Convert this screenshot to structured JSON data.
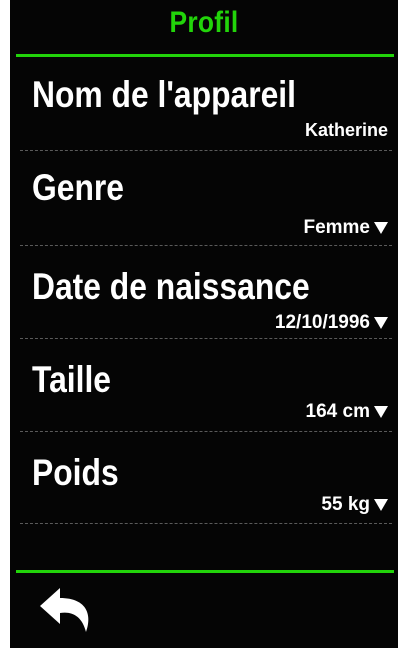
{
  "header": {
    "title": "Profil"
  },
  "fields": [
    {
      "label": "Nom de l'appareil",
      "value": "Katherine",
      "has_dropdown": false
    },
    {
      "label": "Genre",
      "value": "Femme",
      "has_dropdown": true
    },
    {
      "label": "Date de naissance",
      "value": "12/10/1996",
      "has_dropdown": true
    },
    {
      "label": "Taille",
      "value": "164 cm",
      "has_dropdown": true
    },
    {
      "label": "Poids",
      "value": "55 kg",
      "has_dropdown": true
    }
  ],
  "footer": {
    "back_icon": "back-arrow-icon"
  },
  "colors": {
    "accent": "#22d40a",
    "background": "#050505",
    "text": "#ffffff",
    "divider": "#5a5a5a"
  }
}
